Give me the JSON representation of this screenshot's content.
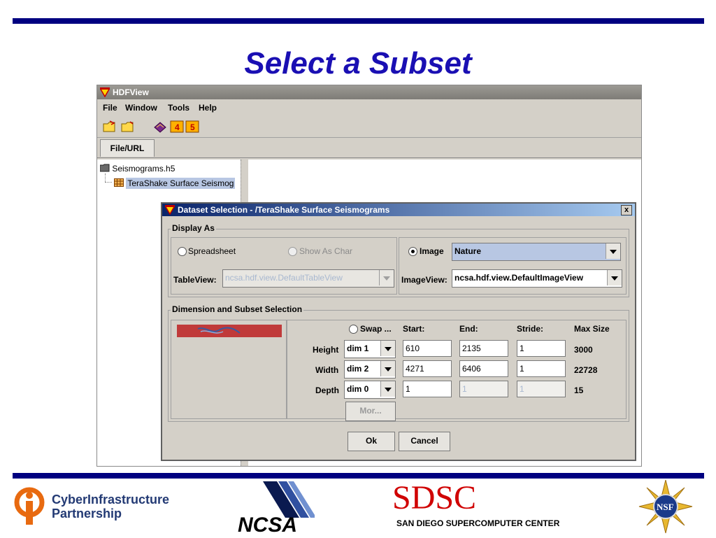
{
  "slide": {
    "title": "Select a Subset"
  },
  "window": {
    "title": "HDFView",
    "menu": [
      "File",
      "Window",
      "Tools",
      "Help"
    ],
    "tab": "File/URL",
    "tree": {
      "file": "Seismograms.h5",
      "dataset": "TeraShake Surface Seismog"
    }
  },
  "dialog": {
    "title": "Dataset Selection - /TeraShake Surface Seismograms",
    "close": "x",
    "display_as": {
      "label": "Display As",
      "spreadsheet": "Spreadsheet",
      "show_as_char": "Show As Char",
      "image": "Image",
      "palette": "Nature",
      "tableview_label": "TableView:",
      "tableview_value": "ncsa.hdf.view.DefaultTableView",
      "imageview_label": "ImageView:",
      "imageview_value": "ncsa.hdf.view.DefaultImageView"
    },
    "dims": {
      "label": "Dimension and Subset Selection",
      "swap": "Swap ...",
      "headers": {
        "start": "Start:",
        "end": "End:",
        "stride": "Stride:",
        "max": "Max Size"
      },
      "rows": [
        {
          "name": "Height",
          "dim": "dim 1",
          "start": "610",
          "end": "2135",
          "stride": "1",
          "max": "3000"
        },
        {
          "name": "Width",
          "dim": "dim 2",
          "start": "4271",
          "end": "6406",
          "stride": "1",
          "max": "22728"
        },
        {
          "name": "Depth",
          "dim": "dim 0",
          "start": "1",
          "end": "1",
          "stride": "1",
          "max": "15"
        }
      ],
      "more": "Mor..."
    },
    "ok": "Ok",
    "cancel": "Cancel"
  },
  "footer": {
    "cip_line1": "CyberInfrastructure",
    "cip_line2": "Partnership",
    "ncsa": "NCSA",
    "sdsc": "SDSC",
    "sdsc_sub": "SAN DIEGO SUPERCOMPUTER CENTER",
    "nsf": "NSF"
  },
  "colors": {
    "rule": "#000080",
    "title": "#1a0fb3",
    "sdsc_red": "#d00000"
  }
}
